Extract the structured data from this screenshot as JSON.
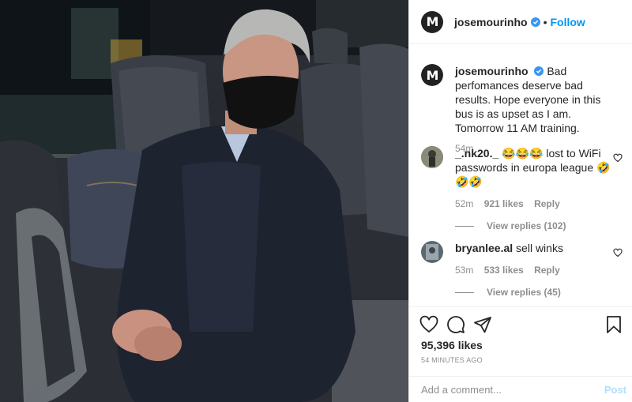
{
  "photo": {
    "alt": ""
  },
  "header": {
    "username": "josemourinho",
    "avatar_letter": "M",
    "separator": "•",
    "follow_label": "Follow"
  },
  "caption": {
    "username": "josemourinho",
    "text": "Bad perfomances deserve bad results. Hope everyone in this bus is as upset as I am. Tomorrow 11 AM training.",
    "time": "54m"
  },
  "comments": [
    {
      "username": "_.nk20._",
      "text": "😂😂😂 lost to WiFi passwords in europa league 🤣🤣🤣",
      "time": "52m",
      "likes": "921 likes",
      "reply_label": "Reply",
      "view_replies": "View replies (102)"
    },
    {
      "username": "bryanlee.al",
      "text": "sell winks",
      "time": "53m",
      "likes": "533 likes",
      "reply_label": "Reply",
      "view_replies": "View replies (45)"
    }
  ],
  "actions": {
    "icons": [
      "heart-icon",
      "comment-icon",
      "share-icon",
      "bookmark-icon"
    ],
    "likes": "95,396 likes",
    "time_ago": "54 MINUTES AGO"
  },
  "add_comment": {
    "placeholder": "Add a comment...",
    "post_label": "Post"
  },
  "colors": {
    "accent": "#0095f6",
    "verified": "#3897f0",
    "muted": "#8e8e8e",
    "border": "#efefef"
  }
}
